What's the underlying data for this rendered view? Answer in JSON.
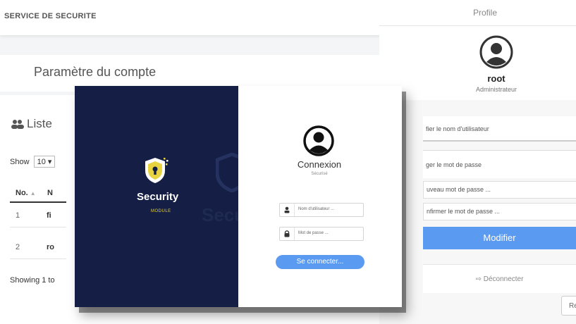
{
  "topbar": {
    "brand": "SERVICE DE SECURITE"
  },
  "account": {
    "title": "Paramètre du compte"
  },
  "list": {
    "title": "Liste",
    "show_label": "Show",
    "show_value": "10",
    "headers": [
      "No.",
      "N"
    ],
    "rows": [
      {
        "no": "1",
        "name": "fi"
      },
      {
        "no": "2",
        "name": "ro"
      }
    ],
    "showing": "Showing 1 to"
  },
  "profile": {
    "header": "Profile",
    "username": "root",
    "role": "Administrateur",
    "edit_username": "fier le nom d'utilisateur",
    "change_password": "ger le mot de passe",
    "new_password_ph": "uveau mot de passe ...",
    "confirm_password_ph": "nfirmer le mot de passe ...",
    "modify_button": "Modifier",
    "logout": "Déconnecter",
    "re_button": "Re"
  },
  "login": {
    "brand": "Security",
    "brand_sub": "MODULE",
    "ghost_brand": "Secu",
    "title": "Connexion",
    "subtitle": "Sécurisé",
    "username_ph": "Nom d'utilisateur ...",
    "password_ph": "Mot de passe ...",
    "submit": "Se connecter..."
  },
  "colors": {
    "navy": "#151f45",
    "accent": "#5a9af0",
    "yellow": "#e8d440"
  }
}
